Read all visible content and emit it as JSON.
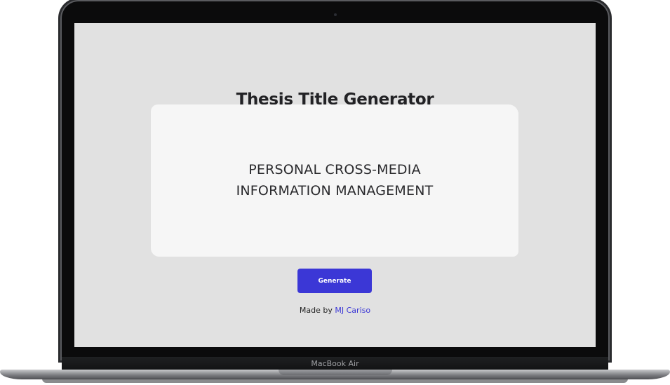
{
  "device": {
    "model_label": "MacBook Air"
  },
  "app": {
    "title": "Thesis Title Generator",
    "accent_color": "#3b37d6",
    "background_color": "#e1e1e1",
    "card_color": "#f6f6f6"
  },
  "result": {
    "line1": "PERSONAL CROSS-MEDIA",
    "line2": "INFORMATION MANAGEMENT"
  },
  "actions": {
    "generate_label": "Generate"
  },
  "footer": {
    "prefix": "Made by",
    "author": "MJ Cariso"
  }
}
